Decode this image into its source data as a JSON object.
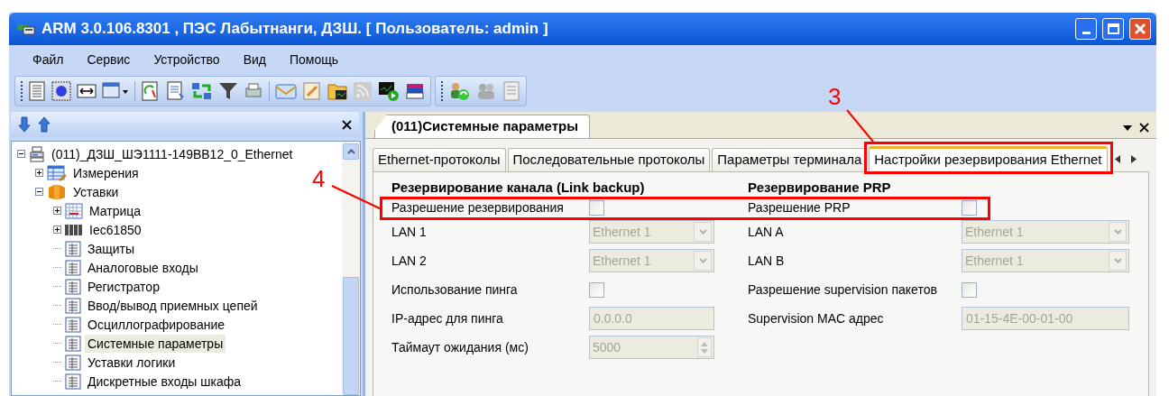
{
  "window": {
    "title": "ARM 3.0.106.8301 , ПЭС Лабытнанги, ДЗШ. [ Пользователь: admin ]"
  },
  "menu": [
    "Файл",
    "Сервис",
    "Устройство",
    "Вид",
    "Помощь"
  ],
  "tree": {
    "label": "(011)_ДЗШ_ШЭ1111-149ВВ12_0_Ethernet",
    "kind": "device",
    "expanded": true,
    "selected": false,
    "children": [
      {
        "label": "Измерения",
        "kind": "table",
        "expanded": false,
        "selected": false
      },
      {
        "label": "Уставки",
        "kind": "folder",
        "expanded": true,
        "selected": false,
        "children": [
          {
            "label": "Матрица",
            "kind": "matrix",
            "expanded": false,
            "selected": false
          },
          {
            "label": "Iec61850",
            "kind": "iec",
            "expanded": false,
            "selected": false
          },
          {
            "label": "Защиты",
            "kind": "page",
            "selected": false
          },
          {
            "label": "Аналоговые входы",
            "kind": "page",
            "selected": false
          },
          {
            "label": "Регистратор",
            "kind": "page",
            "selected": false
          },
          {
            "label": "Ввод/вывод приемных цепей",
            "kind": "page",
            "selected": false
          },
          {
            "label": "Осциллографирование",
            "kind": "page",
            "selected": false
          },
          {
            "label": "Системные параметры",
            "kind": "page",
            "selected": true
          },
          {
            "label": "Уставки логики",
            "kind": "page",
            "selected": false
          },
          {
            "label": "Дискретные входы шкафа",
            "kind": "page",
            "selected": false
          }
        ]
      }
    ]
  },
  "document_tab": {
    "label": "(011)Системные параметры"
  },
  "tabs": [
    {
      "label": "Ethernet-протоколы",
      "selected": false
    },
    {
      "label": "Последовательные протоколы",
      "selected": false
    },
    {
      "label": "Параметры терминала",
      "selected": false
    },
    {
      "label": "Настройки резервирования Ethernet",
      "selected": true
    }
  ],
  "sections": [
    {
      "heading": "Резервирование канала (Link backup)",
      "fields": [
        {
          "label": "Разрешение резервирования",
          "kind": "checkbox",
          "checked": false
        },
        {
          "label": "LAN 1",
          "kind": "select",
          "value": "Ethernet 1",
          "disabled": true
        },
        {
          "label": "LAN 2",
          "kind": "select",
          "value": "Ethernet 1",
          "disabled": true
        },
        {
          "label": "Использование пинга",
          "kind": "checkbox",
          "checked": false
        },
        {
          "label": "IP-адрес для пинга",
          "kind": "text",
          "value": "0.0.0.0",
          "disabled": true
        },
        {
          "label": "Таймаут ожидания (мс)",
          "kind": "spin",
          "value": "5000",
          "disabled": true
        }
      ]
    },
    {
      "heading": "Резервирование PRP",
      "fields": [
        {
          "label": "Разрешение PRP",
          "kind": "checkbox",
          "checked": false
        },
        {
          "label": "LAN A",
          "kind": "select",
          "value": "Ethernet 1",
          "disabled": true
        },
        {
          "label": "LAN B",
          "kind": "select",
          "value": "Ethernet 1",
          "disabled": true
        },
        {
          "label": "Разрешение supervision пакетов",
          "kind": "checkbox",
          "checked": false
        },
        {
          "label": "Supervision MAC адрес",
          "kind": "text",
          "value": "01-15-4E-00-01-00",
          "disabled": true
        }
      ]
    }
  ],
  "annotations": [
    {
      "number": "3"
    },
    {
      "number": "4"
    }
  ]
}
